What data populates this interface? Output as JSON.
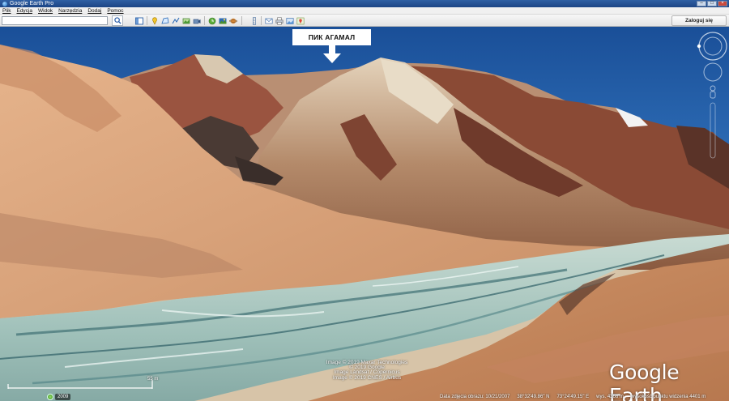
{
  "window": {
    "title": "Google Earth Pro"
  },
  "menu": {
    "items": [
      "Plik",
      "Edycja",
      "Widok",
      "Narzędzia",
      "Dodaj",
      "Pomoc"
    ]
  },
  "toolbar": {
    "search_value": "",
    "search_icon": "magnifier-icon",
    "tools": [
      "sidebar-toggle-icon",
      "placemark-icon",
      "polygon-icon",
      "path-icon",
      "image-overlay-icon",
      "record-tour-icon",
      "historical-imagery-icon",
      "sunlight-icon",
      "planets-icon",
      "ruler-icon",
      "email-icon",
      "print-icon",
      "save-image-icon",
      "google-maps-icon"
    ],
    "signin_label": "Zaloguj się"
  },
  "view": {
    "annotation_label": "ПИК АГАМАЛ",
    "attribution": [
      "Image © 2019 Maxar Technologies",
      "© 2019 Google",
      "Image Landsat / Copernicus",
      "Image © 2019 CNES / Airbus"
    ],
    "logo": "Google Earth",
    "scale_label": "55 m",
    "imagery_year": "2009",
    "status": {
      "imagery_date": "Data zdjęcia obrazu: 10/21/2007",
      "lat": "38°32'49.86\" N",
      "lon": "73°24'49.15\" E",
      "elevation": "wys. 4366 m",
      "eye_alt": "wysokość punktu widzenia 4401 m"
    },
    "colors": {
      "sky": "#2b6bb5",
      "river": "#a7c9c2",
      "slope": "#d9a57a",
      "rock": "#7a3b2b"
    }
  }
}
